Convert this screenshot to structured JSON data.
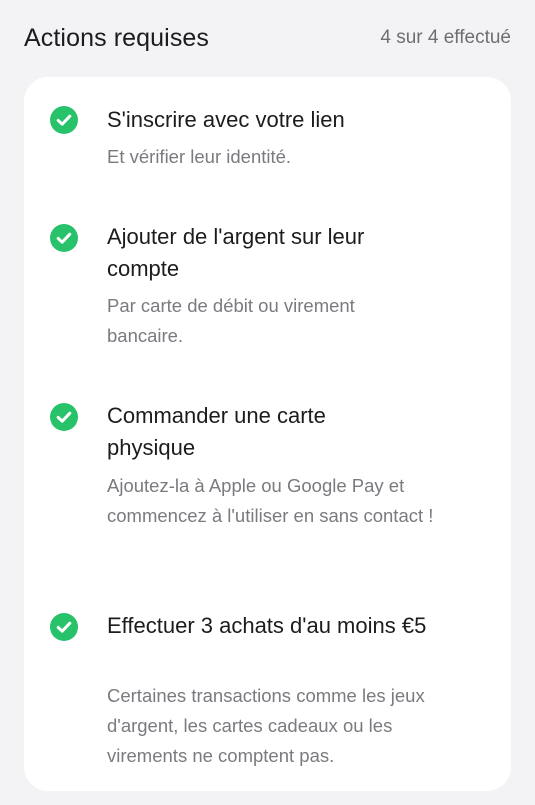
{
  "header": {
    "title": "Actions requises",
    "progress": "4 sur 4 effectué"
  },
  "tasks": [
    {
      "title": "S'inscrire avec votre lien",
      "description": "Et vérifier leur identité.",
      "status": "completed",
      "icon": "check-circle-icon"
    },
    {
      "title": "Ajouter de l'argent sur leur compte",
      "description": "Par carte de débit ou virement bancaire.",
      "status": "completed",
      "icon": "check-circle-icon"
    },
    {
      "title": "Commander une carte physique",
      "description": "Ajoutez-la à Apple ou Google Pay et commencez à l'utiliser en sans contact !",
      "status": "completed",
      "icon": "check-circle-icon"
    },
    {
      "title": "Effectuer 3 achats d'au moins €5",
      "description": "Certaines transactions comme les jeux d'argent, les cartes cadeaux ou les virements ne comptent pas.",
      "status": "completed",
      "icon": "check-circle-icon"
    }
  ],
  "colors": {
    "check": "#27c26a",
    "background": "#f3f3f5",
    "card": "#ffffff",
    "secondary_text": "#7a7a80"
  }
}
